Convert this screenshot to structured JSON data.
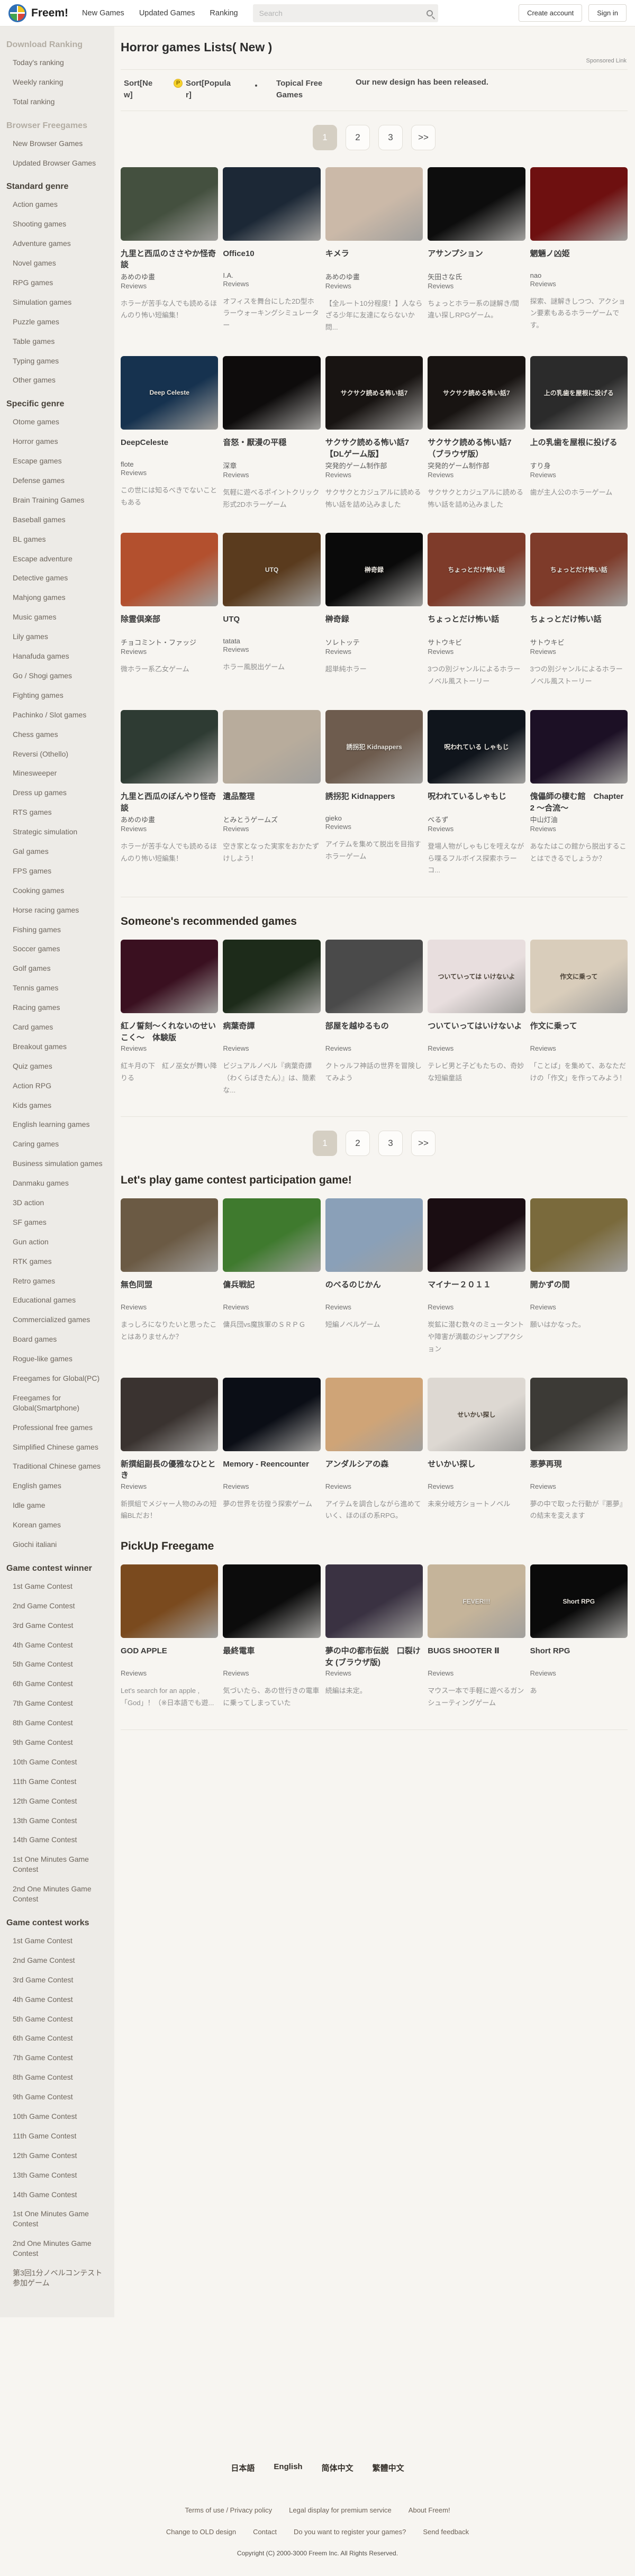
{
  "header": {
    "logo_text": "Freem!",
    "nav": [
      "New Games",
      "Updated Games",
      "Ranking"
    ],
    "search_placeholder": "Search",
    "create_account_label": "Create account",
    "sign_in_label": "Sign in"
  },
  "sidebar": {
    "sections": [
      {
        "title": "Download Ranking",
        "muted": true,
        "items": [
          "Today's ranking",
          "Weekly ranking",
          "Total ranking"
        ]
      },
      {
        "title": "Browser Freegames",
        "muted": true,
        "items": [
          "New Browser Games",
          "Updated Browser Games"
        ]
      },
      {
        "title": "Standard genre",
        "muted": false,
        "items": [
          "Action games",
          "Shooting games",
          "Adventure games",
          "Novel games",
          "RPG games",
          "Simulation games",
          "Puzzle games",
          "Table games",
          "Typing games",
          "Other games"
        ]
      },
      {
        "title": "Specific genre",
        "muted": false,
        "items": [
          "Otome games",
          "Horror games",
          "Escape games",
          "Defense games",
          "Brain Training Games",
          "Baseball games",
          "BL games",
          "Escape adventure",
          "Detective games",
          "Mahjong games",
          "Music games",
          "Lily games",
          "Hanafuda games",
          "Go / Shogi games",
          "Fighting games",
          "Pachinko / Slot games",
          "Chess games",
          "Reversi (Othello)",
          "Minesweeper",
          "Dress up games",
          "RTS games",
          "Strategic simulation",
          "Gal games",
          "FPS games",
          "Cooking games",
          "Horse racing games",
          "Fishing games",
          "Soccer games",
          "Golf games",
          "Tennis games",
          "Racing games",
          "Card games",
          "Breakout games",
          "Quiz games",
          "Action RPG",
          "Kids games",
          "English learning games",
          "Caring games",
          "Business simulation games",
          "Danmaku games",
          "3D action",
          "SF games",
          "Gun action",
          "RTK games",
          "Retro games",
          "Educational games",
          "Commercialized games",
          "Board games",
          "Rogue-like games",
          "Freegames for Global(PC)",
          "Freegames for Global(Smartphone)",
          "Professional free games",
          "Simplified Chinese games",
          "Traditional Chinese games",
          "English games",
          "Idle game",
          "Korean games",
          "Giochi italiani"
        ]
      },
      {
        "title": "Game contest winner",
        "muted": false,
        "items": [
          "1st Game Contest",
          "2nd Game Contest",
          "3rd Game Contest",
          "4th Game Contest",
          "5th Game Contest",
          "6th Game Contest",
          "7th Game Contest",
          "8th Game Contest",
          "9th Game Contest",
          "10th Game Contest",
          "11th Game Contest",
          "12th Game Contest",
          "13th Game Contest",
          "14th Game Contest",
          "1st One Minutes Game Contest",
          "2nd One Minutes Game Contest"
        ]
      },
      {
        "title": "Game contest works",
        "muted": false,
        "items": [
          "1st Game Contest",
          "2nd Game Contest",
          "3rd Game Contest",
          "4th Game Contest",
          "5th Game Contest",
          "6th Game Contest",
          "7th Game Contest",
          "8th Game Contest",
          "9th Game Contest",
          "10th Game Contest",
          "11th Game Contest",
          "12th Game Contest",
          "13th Game Contest",
          "14th Game Contest",
          "1st One Minutes Game Contest",
          "2nd One Minutes Game Contest",
          "第3回1分ノベルコンテスト参加ゲーム"
        ]
      }
    ]
  },
  "main": {
    "title": "Horror games Lists( New )",
    "sponsored_label": "Sponsored Link",
    "toolbar": {
      "sort_new": "Sort[New]",
      "sort_popular": "Sort[Popular]",
      "p_icon": "P",
      "separator": "・",
      "topical": "Topical Free Games",
      "announcement": "Our new design has been released."
    },
    "reviews_label": "Reviews",
    "pagination": [
      {
        "label": "1",
        "active": true
      },
      {
        "label": "2",
        "active": false
      },
      {
        "label": "3",
        "active": false
      },
      {
        "label": ">>",
        "active": false
      }
    ],
    "sections": [
      {
        "heading": null,
        "pagination_top": true,
        "games": [
          {
            "title": "九里と西瓜のささやか怪奇談",
            "author": "あめのゆ畫",
            "desc": "ホラーが苦手な人でも読めるほんのり怖い短編集！",
            "thumb": "#44503f"
          },
          {
            "title": "Office10",
            "author": "I.A.",
            "desc": "オフィスを舞台にした2D型ホラーウォーキングシミュレーター",
            "thumb": "#1c2836"
          },
          {
            "title": "キメラ",
            "author": "あめのゆ畫",
            "desc": "【全ルート10分程度！】人ならざる少年に友達にならないか問...",
            "thumb": "#cbb9a8"
          },
          {
            "title": "アサンプション",
            "author": "矢田さな氏",
            "desc": "ちょっとホラー系の謎解き/間違い探しRPGゲーム。",
            "thumb": "#0d0d0d"
          },
          {
            "title": "魍魎ノ凶姫",
            "author": "nao",
            "desc": "探索、謎解きしつつ、アクション要素もあるホラーゲームです。",
            "thumb": "#6e1010"
          },
          {
            "title": "DeepCeleste",
            "author": "flote",
            "desc": "この世には知るべきでないこともある",
            "thumb": "#16324f",
            "thumb_text": "Deep Celeste"
          },
          {
            "title": "音怒・厭漫の平穏",
            "author": "深章",
            "desc": "気軽に遊べるポイントクリック形式2Dホラーゲーム",
            "thumb": "#0e0c0c"
          },
          {
            "title": "サクサク読める怖い話7【DLゲーム版】",
            "author": "突発的ゲーム制作部",
            "desc": "サクサクとカジュアルに読める怖い話を詰め込みました",
            "thumb": "#181412",
            "thumb_text": "サクサク読める怖い話7"
          },
          {
            "title": "サクサク読める怖い話7（ブラウザ版）",
            "author": "突発的ゲーム制作部",
            "desc": "サクサクとカジュアルに読める怖い話を詰め込みました",
            "thumb": "#181412",
            "thumb_text": "サクサク読める怖い話7"
          },
          {
            "title": "上の乳歯を屋根に投げる",
            "author": "すり身",
            "desc": "歯が主人公のホラーゲーム",
            "thumb": "#2b2b2b",
            "thumb_text": "上の乳歯を屋根に投げる"
          },
          {
            "title": "除霊倶楽部",
            "author": "チョコミント・ファッジ",
            "desc": "微ホラー系乙女ゲーム",
            "thumb": "#b3502e"
          },
          {
            "title": "UTQ",
            "author": "tatata",
            "desc": "ホラー風脱出ゲーム",
            "thumb": "#5a3b1e",
            "thumb_text": "UTQ"
          },
          {
            "title": "榊奇録",
            "author": "ソレトッテ",
            "desc": "超単純ホラー",
            "thumb": "#0a0a0a",
            "thumb_text": "榊奇録"
          },
          {
            "title": "ちょっとだけ怖い話",
            "author": "サトウキビ",
            "desc": "3つの別ジャンルによるホラーノベル風ストーリー",
            "thumb": "#7e3b2a",
            "thumb_text": "ちょっとだけ怖い話"
          },
          {
            "title": "ちょっとだけ怖い話",
            "author": "サトウキビ",
            "desc": "3つの別ジャンルによるホラーノベル風ストーリー",
            "thumb": "#7e3b2a",
            "thumb_text": "ちょっとだけ怖い話"
          },
          {
            "title": "九里と西瓜のぼんやり怪奇談",
            "author": "あめのゆ畫",
            "desc": "ホラーが苦手な人でも読めるほんのり怖い短編集！",
            "thumb": "#2e3b33"
          },
          {
            "title": "遺品整理",
            "author": "とみとうゲームズ",
            "desc": "空き家となった実家をおかたずけしよう！",
            "thumb": "#b8ac9c"
          },
          {
            "title": "誘拐犯 Kidnappers",
            "author": "gieko",
            "desc": "アイテムを集めて脱出を目指すホラーゲーム",
            "thumb": "#6e5c4e",
            "thumb_text": "誘拐犯 Kidnappers"
          },
          {
            "title": "呪われているしゃもじ",
            "author": "べるず",
            "desc": "登場人物がしゃもじを咥えながら喋るフルボイス探索ホラーコ...",
            "thumb": "#10151c",
            "thumb_text": "呪われている しゃもじ"
          },
          {
            "title": "傀儡師の棲む館　Chapter 2 ～合流～",
            "author": "中山灯油",
            "desc": "あなたはこの館から脱出することはできるでしょうか？",
            "thumb": "#1c1025"
          }
        ]
      },
      {
        "heading": "Someone's recommended games",
        "divider_before": true,
        "pagination_bottom": true,
        "games": [
          {
            "title": "紅ノ誓刻～くれないのせいこく～　体験版",
            "desc": "紅キ月の下　紅ノ巫女が舞い降りる",
            "thumb": "#3a1020"
          },
          {
            "title": "病葉奇譚",
            "desc": "ビジュアルノベル『病葉奇譚（わくらばきたん）』は、簡素な...",
            "thumb": "#1d2b1a"
          },
          {
            "title": "部屋を越ゆるもの",
            "desc": "クトゥルフ神話の世界を冒険してみよう",
            "thumb": "#4a4a4a"
          },
          {
            "title": "ついていってはいけないよ",
            "desc": "テレビ男と子どもたちの、奇妙な短編童話",
            "thumb": "#e8dede",
            "thumb_text": "ついていっては いけないよ",
            "thumb_text_dark": true
          },
          {
            "title": "作文に乗って",
            "desc": "「ことば」を集めて、あなただけの「作文」を作ってみよう！",
            "thumb": "#d9cdbb",
            "thumb_text": "作文に乗って",
            "thumb_text_dark": true
          }
        ]
      },
      {
        "heading": "Let's play game contest participation game!",
        "games": [
          {
            "title": "無色同盟",
            "desc": "まっしろになりたいと思ったことはありませんか？",
            "thumb": "#6b5a44"
          },
          {
            "title": "傭兵戦記",
            "desc": "傭兵団vs魔族軍のＳＲＰＧ",
            "thumb": "#3f7a2e"
          },
          {
            "title": "のべるのじかん",
            "desc": "短編ノベルゲーム",
            "thumb": "#8aa0b8"
          },
          {
            "title": "マイナー２０１１",
            "desc": "炭鉱に潜む数々のミュータントや障害が満載のジャンプアクション",
            "thumb": "#1a0d12"
          },
          {
            "title": "開かずの間",
            "desc": "願いはかなった。",
            "thumb": "#7a6a3c"
          },
          {
            "title": "新撰組副長の優雅なひととき",
            "desc": "新撰組でメジャー人物のみの短編BLだお！",
            "thumb": "#3a3330"
          },
          {
            "title": "Memory - Reencounter",
            "desc": "夢の世界を彷徨う探索ゲーム",
            "thumb": "#0b0e16"
          },
          {
            "title": "アンダルシアの森",
            "desc": "アイテムを調合しながら進めていく、ほのぼの系RPG。",
            "thumb": "#cfa477"
          },
          {
            "title": "せいかい探し",
            "desc": "未来分岐方ショートノベル",
            "thumb": "#ddd8d2",
            "thumb_text": "せいかい探し",
            "thumb_text_dark": true
          },
          {
            "title": "悪夢再現",
            "desc": "夢の中で取った行動が『悪夢』の結末を変えます",
            "thumb": "#3c3a36"
          }
        ]
      },
      {
        "heading": "PickUp Freegame",
        "divider_after": true,
        "games": [
          {
            "title": "GOD APPLE",
            "desc": "Let's search for an apple ,「God」！（※日本語でも遊...",
            "thumb": "#7a4a1e"
          },
          {
            "title": "最終電車",
            "desc": "気づいたら、あの世行きの電車に乗ってしまっていた",
            "thumb": "#0c0c0c"
          },
          {
            "title": "夢の中の都市伝説　口裂け女 (ブラウザ版)",
            "desc": "続編は未定。",
            "thumb": "#3a3242"
          },
          {
            "title": "BUGS SHOOTER Ⅱ",
            "desc": "マウス一本で手軽に遊べるガンシューティングゲーム",
            "thumb": "#c5b49a",
            "thumb_text": "FEVER!!!"
          },
          {
            "title": "Short RPG",
            "desc": "あ",
            "thumb": "#0a0a0a",
            "thumb_text": "Short RPG"
          }
        ]
      }
    ]
  },
  "footer": {
    "languages": [
      "日本語",
      "English",
      "简体中文",
      "繁體中文"
    ],
    "links_row1": [
      "Terms of use / Privacy policy",
      "Legal display for premium service",
      "About Freem!"
    ],
    "links_row2": [
      "Change to OLD design",
      "Contact",
      "Do you want to register your games?",
      "Send feedback"
    ],
    "copyright": "Copyright (C) 2000-3000 Freem Inc. All Rights Reserved."
  }
}
